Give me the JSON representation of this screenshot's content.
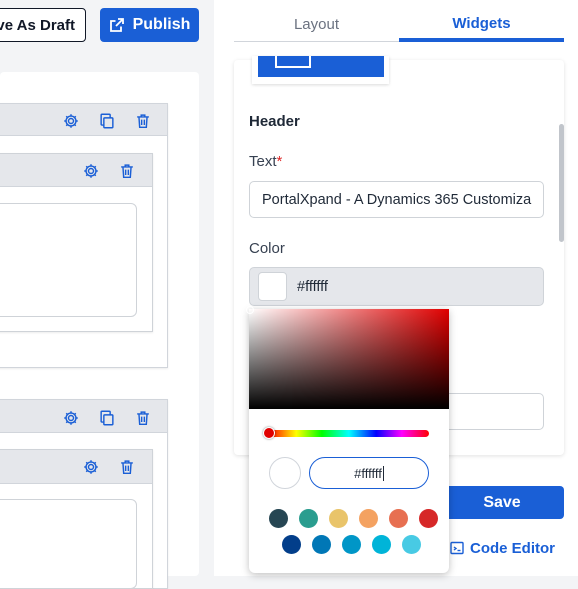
{
  "toolbar": {
    "save_draft_label": "ve As Draft",
    "publish_label": "Publish"
  },
  "tabs": [
    {
      "label": "Layout",
      "active": false
    },
    {
      "label": "Widgets",
      "active": true
    }
  ],
  "panel": {
    "section_title": "Header",
    "text_label": "Text",
    "required_mark": "*",
    "text_value": "PortalXpand - A Dynamics 365 Customiza",
    "color_label": "Color",
    "color_value": "#ffffff",
    "save_label": "Save",
    "code_editor_label": "Code Editor"
  },
  "color_picker": {
    "hex_value": "#ffffff",
    "hue_color": "#e00000",
    "swatches_row1": [
      "#264653",
      "#2a9d8f",
      "#e9c46a",
      "#f4a261",
      "#e76f51",
      "#d62828"
    ],
    "swatches_row2": [
      "#023e8a",
      "#0077b6",
      "#0096c7",
      "#00b4d8",
      "#48cae4"
    ]
  },
  "colors": {
    "accent": "#1a5fd6",
    "card_header": "#e5e7eb"
  }
}
